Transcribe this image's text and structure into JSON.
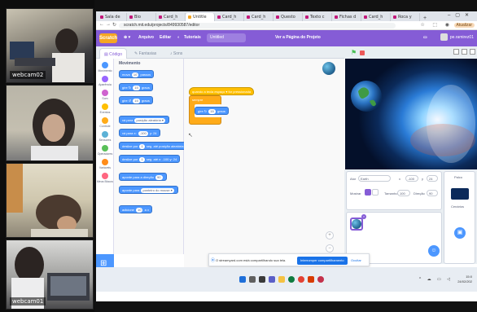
{
  "webcams": [
    {
      "label": "webcam02"
    },
    {
      "label": ""
    },
    {
      "label": ""
    },
    {
      "label": "webcam01"
    }
  ],
  "browser": {
    "tabs": [
      "Sala de",
      "Bio",
      "Card_h",
      "Untitle",
      "Card_h",
      "Card_h",
      "Questo",
      "Texto c",
      "Fichas d",
      "Card_h",
      "Roca y"
    ],
    "active_tab": 3,
    "url": "scratch.mit.edu/projects/849930587/editor",
    "update_label": "Atualizar"
  },
  "scratch": {
    "logo": "Scratch",
    "menu": {
      "file": "Arquivo",
      "edit": "Editar",
      "tutorials": "Tutoriais",
      "see_project": "Ver a Página do Projeto"
    },
    "project_title": "Untitled",
    "username": "pe.ramirez01",
    "tabs": {
      "code": "Código",
      "costumes": "Fantasias",
      "sounds": "Sons"
    },
    "categories": [
      {
        "label": "Movimento",
        "color": "#4c97ff"
      },
      {
        "label": "Aparência",
        "color": "#9966ff"
      },
      {
        "label": "Som",
        "color": "#cf63cf"
      },
      {
        "label": "Eventos",
        "color": "#ffbf00"
      },
      {
        "label": "Controle",
        "color": "#ffab19"
      },
      {
        "label": "Sensores",
        "color": "#5cb1d6"
      },
      {
        "label": "Operadores",
        "color": "#59c059"
      },
      {
        "label": "Variáveis",
        "color": "#ff8c1a"
      },
      {
        "label": "Meus Blocos",
        "color": "#ff6680"
      }
    ],
    "palette_title": "Movimento",
    "blocks": [
      {
        "pre": "mova",
        "val": "10",
        "post": "passos"
      },
      {
        "pre": "gire ↻",
        "val": "15",
        "post": "graus"
      },
      {
        "pre": "gire ↺",
        "val": "15",
        "post": "graus"
      },
      {
        "pre": "vá para",
        "val": "posição aleatória ▾",
        "post": ""
      },
      {
        "pre": "vá para x:",
        "val": "-100",
        "post": "y: 24"
      },
      {
        "pre": "deslize por",
        "val": "1",
        "post": "seg. até posição aleatória"
      },
      {
        "pre": "deslize por",
        "val": "1",
        "post": "seg. até x: -100 y: 24"
      },
      {
        "pre": "aponte para a direção",
        "val": "90",
        "post": ""
      },
      {
        "pre": "aponte para",
        "val": "ponteiro do mouse ▾",
        "post": ""
      },
      {
        "pre": "adicione",
        "val": "10",
        "post": "a x"
      }
    ],
    "script": {
      "hat": "quando a tecla espaço ▾ for pressionada",
      "loop": "sempre",
      "inner_pre": "gire ↻",
      "inner_val": "15",
      "inner_post": "graus"
    },
    "sprite_info": {
      "sprite_label": "Ator",
      "sprite_name": "Earth",
      "x_label": "x",
      "x_value": "-100",
      "y_label": "y",
      "y_value": "24",
      "show_label": "Mostrar",
      "size_label": "Tamanho",
      "size_value": "100",
      "direction_label": "Direção",
      "direction_value": "90"
    },
    "stage_label": "Palco",
    "backdrops_label": "Cenários"
  },
  "share_bar": {
    "message": "O streamyard.com está compartilhando sua tela.",
    "stop": "Interromper compartilhamento",
    "hide": "Ocultar"
  },
  "taskbar": {
    "time": "15:0",
    "date": "24/02/202"
  }
}
